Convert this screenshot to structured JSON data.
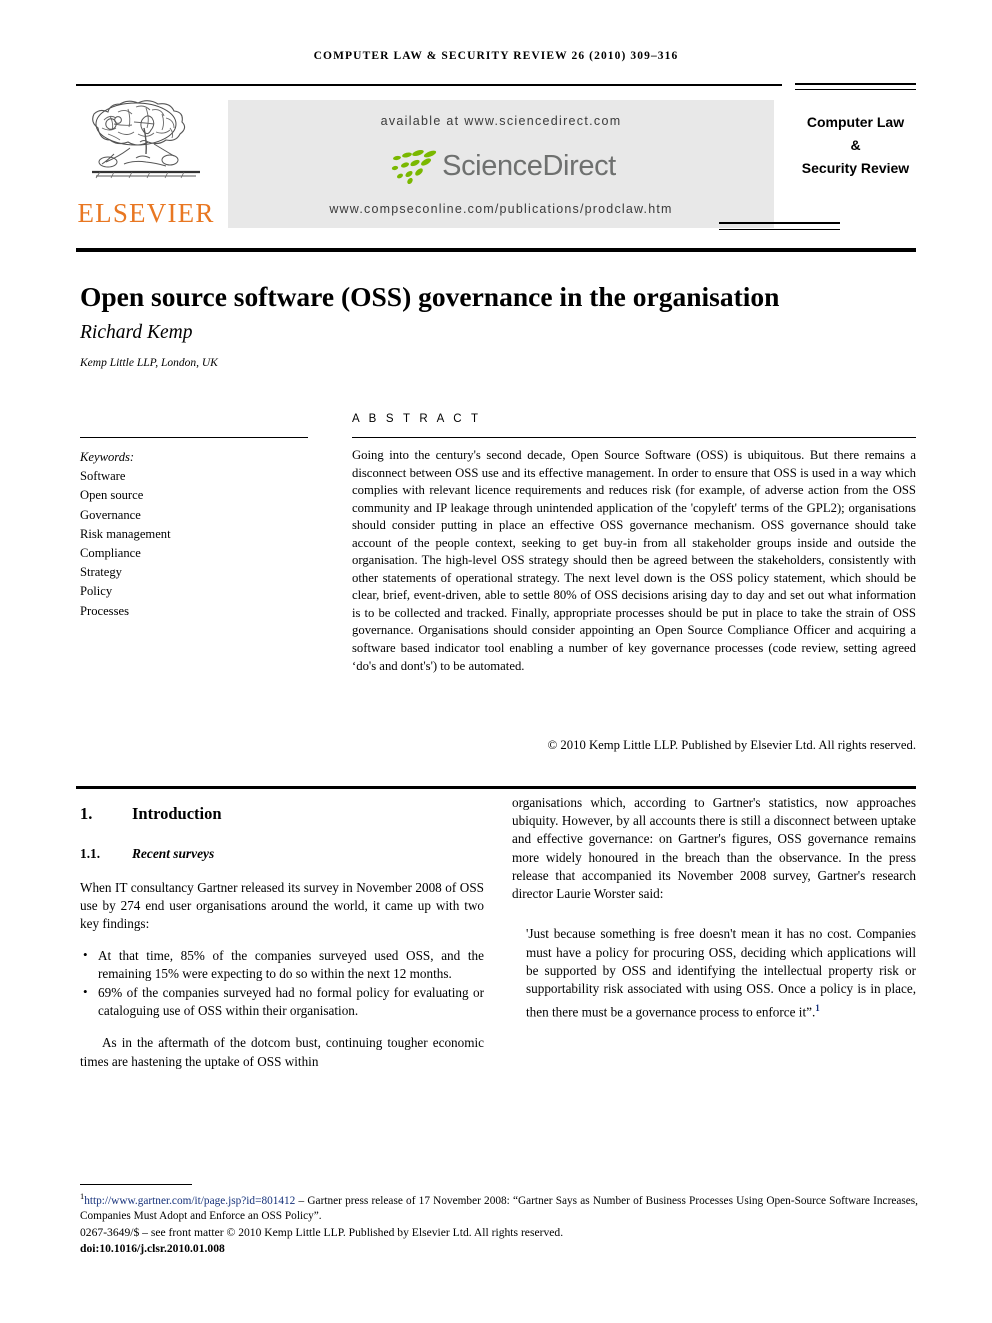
{
  "running_head": "COMPUTER LAW & SECURITY REVIEW 26 (2010) 309–316",
  "masthead": {
    "publisher_name": "ELSEVIER",
    "publisher_logo_alt": "elsevier-tree-logo",
    "available_at": "available at www.sciencedirect.com",
    "sciencedirect_wordmark": "ScienceDirect",
    "journal_url": "www.compseconline.com/publications/prodclaw.htm",
    "journal_box_lines": [
      "Computer Law",
      "&",
      "Security Review"
    ],
    "accent_orange": "#E87722",
    "sciencedirect_green": "#7AB800",
    "sciencedirect_grey": "#6e706f",
    "band_background": "#e8e8e8"
  },
  "article": {
    "title": "Open source software (OSS) governance in the organisation",
    "author": "Richard Kemp",
    "affiliation": "Kemp Little LLP, London, UK"
  },
  "keywords": {
    "label": "Keywords:",
    "items": [
      "Software",
      "Open source",
      "Governance",
      "Risk management",
      "Compliance",
      "Strategy",
      "Policy",
      "Processes"
    ]
  },
  "abstract": {
    "label": "A B S T R A C T",
    "text": "Going into the century's second decade, Open Source Software (OSS) is ubiquitous. But there remains a disconnect between OSS use and its effective management. In order to ensure that OSS is used in a way which complies with relevant licence requirements and reduces risk (for example, of adverse action from the OSS community and IP leakage through unintended application of the 'copyleft' terms of the GPL2); organisations should consider putting in place an effective OSS governance mechanism. OSS governance should take account of the people context, seeking to get buy-in from all stakeholder groups inside and outside the organisation. The high-level OSS strategy should then be agreed between the stakeholders, consistently with other statements of operational strategy. The next level down is the OSS policy statement, which should be clear, brief, event-driven, able to settle 80% of OSS decisions arising day to day and set out what information is to be collected and tracked. Finally, appropriate processes should be put in place to take the strain of OSS governance. Organisations should consider appointing an Open Source Compliance Officer and acquiring a software based indicator tool enabling a number of key governance processes (code review, setting agreed ‘do's and dont's') to be automated.",
    "copyright": "© 2010 Kemp Little LLP. Published by Elsevier Ltd. All rights reserved."
  },
  "sections": {
    "intro_number": "1.",
    "intro_title": "Introduction",
    "subsection_number": "1.1.",
    "subsection_title": "Recent surveys"
  },
  "body": {
    "left": {
      "para1": "When IT consultancy Gartner released its survey in November 2008 of OSS use by 274 end user organisations around the world, it came up with two key findings:",
      "findings": [
        "At that time, 85% of the companies surveyed used OSS, and the remaining 15% were expecting to do so within the next 12 months.",
        "69% of the companies surveyed had no formal policy for evaluating or cataloguing use of OSS within their organisation."
      ],
      "para2": "As in the aftermath of the dotcom bust, continuing tougher economic times are hastening the uptake of OSS within"
    },
    "right": {
      "para1": "organisations which, according to Gartner's statistics, now approaches ubiquity. However, by all accounts there is still a disconnect between uptake and effective governance: on Gartner's figures, OSS governance remains more widely honoured in the breach than the observance. In the press release that accompanied its November 2008 survey, Gartner's research director Laurie Worster said:",
      "quote": "'Just because something is free doesn't mean it has no cost. Companies must have a policy for procuring OSS, deciding which applications will be supported by OSS and identifying the intellectual property risk or supportability risk associated with using OSS. Once a policy is in place, then there must be a governance process to enforce it”.",
      "quote_footnote_marker": "1"
    }
  },
  "footnote": {
    "marker": "1",
    "url": "http://www.gartner.com/it/page.jsp?id=801412",
    "text": " – Gartner press release of 17 November 2008: “Gartner Says as Number of Business Processes Using Open-Source Software Increases, Companies Must Adopt and Enforce an OSS Policy”.",
    "link_color": "#14307a"
  },
  "imprint": {
    "line": "0267-3649/$ – see front matter © 2010 Kemp Little LLP. Published by Elsevier Ltd. All rights reserved.",
    "doi": "doi:10.1016/j.clsr.2010.01.008"
  }
}
